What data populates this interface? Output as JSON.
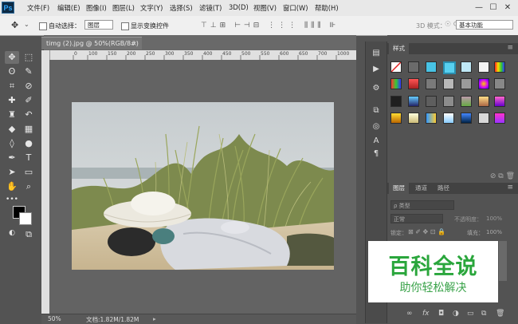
{
  "app": {
    "logo": "Ps"
  },
  "menu": [
    "文件(F)",
    "编辑(E)",
    "图像(I)",
    "图层(L)",
    "文字(Y)",
    "选择(S)",
    "滤镜(T)",
    "3D(D)",
    "视图(V)",
    "窗口(W)",
    "帮助(H)"
  ],
  "window_controls": [
    "—",
    "☐",
    "✕"
  ],
  "options": {
    "auto_select_label": "自动选择：",
    "auto_select_value": "图层",
    "transform_label": "显示变换控件",
    "mode_3d": "3D 模式：",
    "workspace": "基本功能"
  },
  "document": {
    "tab_title": "timg (2).jpg @ 50%(RGB/8#)",
    "close": "×",
    "ruler_ticks": [
      "0",
      "100",
      "150",
      "200",
      "250",
      "300",
      "350",
      "400",
      "450",
      "500",
      "550",
      "600",
      "650",
      "700",
      "750",
      "800",
      "850",
      "900",
      "950",
      "1000"
    ]
  },
  "status": {
    "zoom": "50%",
    "doc_info": "文档:1.82M/1.82M"
  },
  "panels": {
    "styles_tab": "样式",
    "layers_tabs": [
      "图层",
      "通道",
      "路径"
    ],
    "kind_filter": "ρ 类型",
    "blend_mode": "正常",
    "opacity_label": "不透明度：",
    "opacity_value": "100%",
    "lock_label": "锁定：",
    "fill_label": "填充：",
    "fill_value": "100%"
  },
  "watermark": {
    "title": "百科全说",
    "subtitle": "助你轻松解决"
  }
}
